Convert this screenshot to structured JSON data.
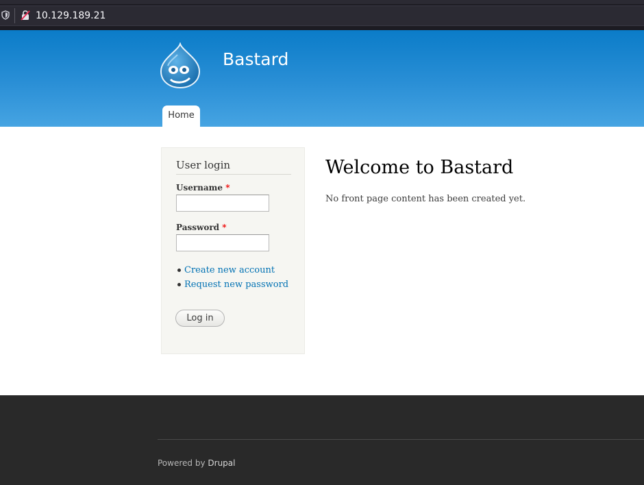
{
  "browser": {
    "url": "10.129.189.21"
  },
  "header": {
    "site_name": "Bastard",
    "nav": [
      {
        "label": "Home"
      }
    ]
  },
  "login_block": {
    "title": "User login",
    "username_label": "Username",
    "password_label": "Password",
    "required_marker": "*",
    "username_value": "",
    "password_value": "",
    "links": [
      {
        "label": "Create new account"
      },
      {
        "label": "Request new password"
      }
    ],
    "submit_label": "Log in"
  },
  "main": {
    "title": "Welcome to Bastard",
    "message": "No front page content has been created yet."
  },
  "footer": {
    "powered_by_prefix": "Powered by",
    "powered_by_link": "Drupal"
  },
  "colors": {
    "header_top": "#0b7cc8",
    "header_bottom": "#46a4e2",
    "link": "#0071b3",
    "footer_bg": "#292929",
    "required": "#ee0000"
  },
  "icons": {
    "tracking_protection": "shield-icon",
    "connection": "insecure-lock-icon",
    "site_logo": "drupal-drop-logo"
  }
}
